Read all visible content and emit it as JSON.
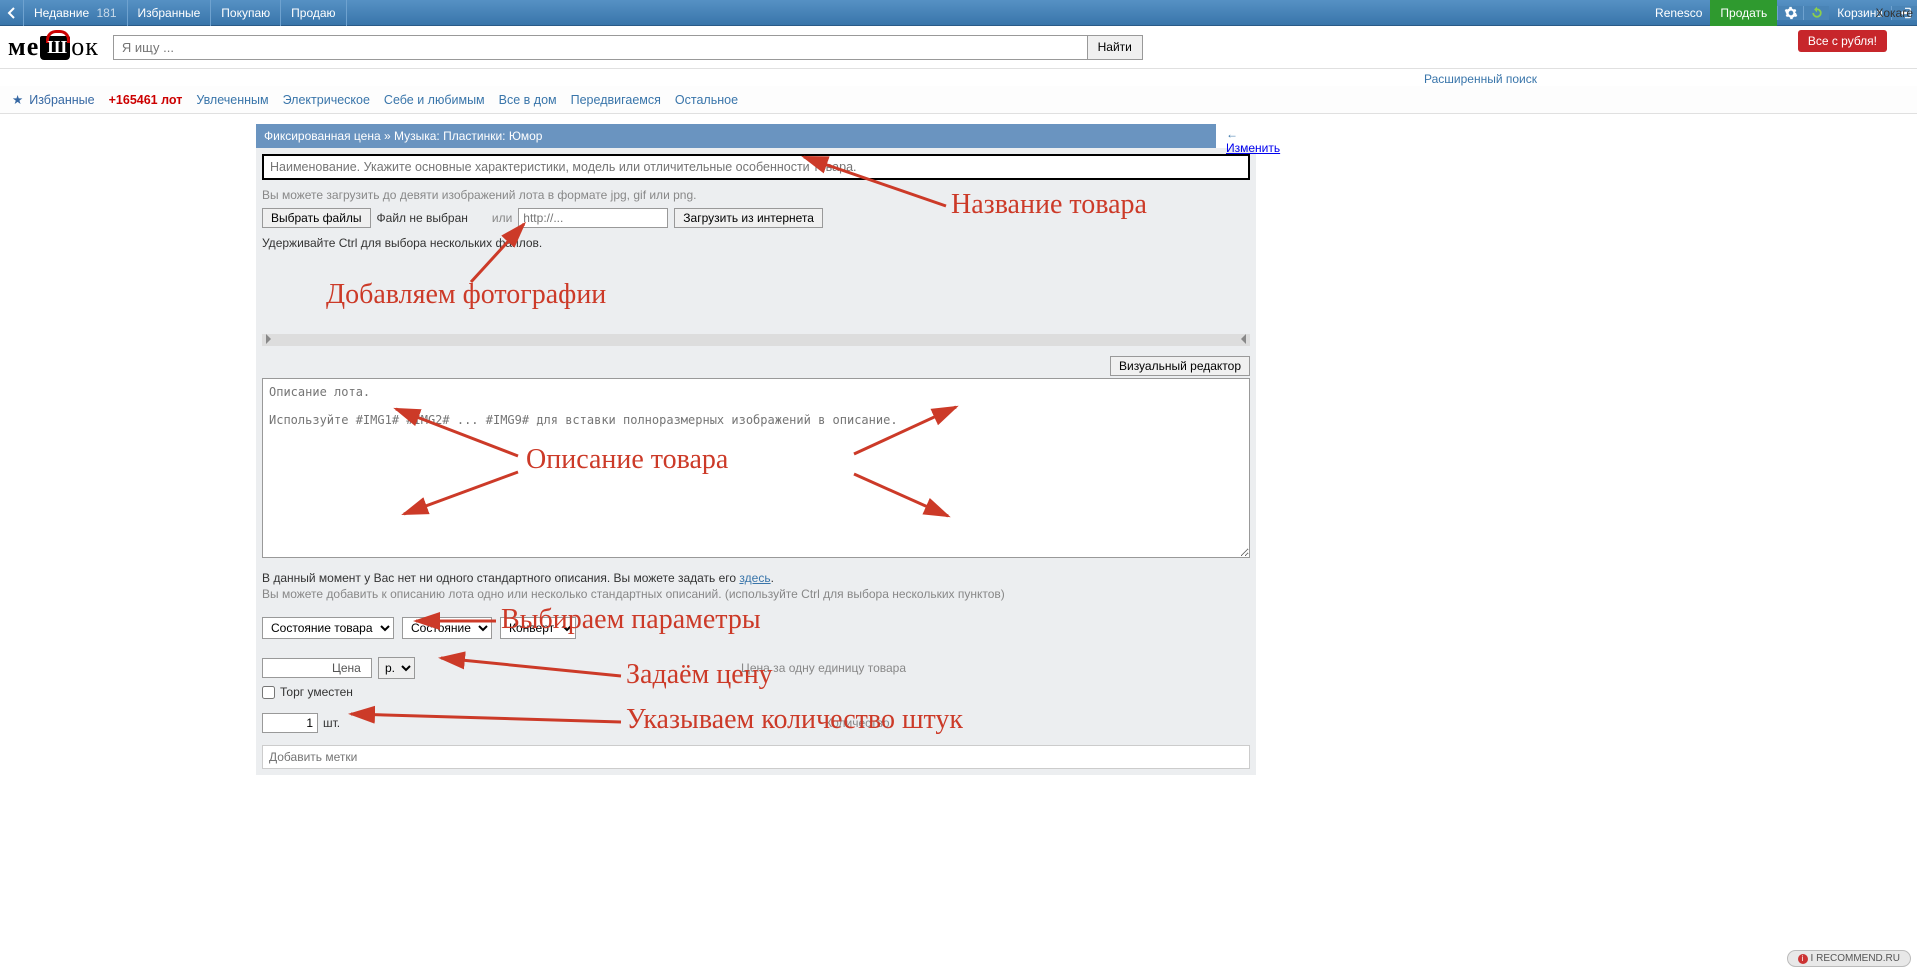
{
  "topnav": {
    "recent": "Недавние",
    "recent_count": "181",
    "favorites": "Избранные",
    "buying": "Покупаю",
    "selling": "Продаю",
    "username": "Renesco",
    "sell": "Продать",
    "cart": "Корзина"
  },
  "corner_user": "Хокаге",
  "logo": {
    "left": "ме",
    "right": "ок"
  },
  "search": {
    "placeholder": "Я ищу ...",
    "button": "Найти",
    "advanced": "Расширенный поиск"
  },
  "promo": "Все с рубля!",
  "categories": {
    "fav": "Избранные",
    "lotcount": "+165461 лот",
    "items": [
      "Увлеченным",
      "Электрическое",
      "Себе и любимым",
      "Все в дом",
      "Передвигаемся",
      "Остальное"
    ]
  },
  "breadcrumb": "Фиксированная цена » Музыка: Пластинки: Юмор",
  "change": "Изменить",
  "title_placeholder": "Наименование. Укажите основные характеристики, модель или отличительные особенности товара.",
  "upload_note": "Вы можете загрузить до девяти изображений лота в формате jpg, gif или png.",
  "choose_files": "Выбрать файлы",
  "no_file": "Файл не выбран",
  "or": "или",
  "url_placeholder": "http://...",
  "load_from_internet": "Загрузить из интернета",
  "ctrl_note": "Удерживайте Ctrl для выбора нескольких файлов.",
  "visual_editor": "Визуальный редактор",
  "desc_placeholder": "Описание лота.\n\nИспользуйте #IMG1# #IMG2# ... #IMG9# для вставки полноразмерных изображений в описание.",
  "std_desc_note_a": "В данный момент у Вас нет ни одного стандартного описания. Вы можете задать его ",
  "std_desc_here": "здесь",
  "std_desc_sub": "Вы можете добавить к описанию лота одно или несколько стандартных описаний. (используйте Ctrl для выбора нескольких пунктов)",
  "selects": {
    "condition": "Состояние товара",
    "state": "Состояние",
    "envelope": "Конверт"
  },
  "price_label": "Цена",
  "currency": "р.",
  "price_unit": "Цена за одну единицу товара",
  "bargain": "Торг уместен",
  "qty_value": "1",
  "qty_suffix": "шт.",
  "qty_label": "Количество",
  "tags_placeholder": "Добавить метки",
  "watermark": "I RECOMMEND.RU",
  "annotations": {
    "title": "Название товара",
    "photos": "Добавляем фотографии",
    "desc": "Описание товара",
    "params": "Выбираем параметры",
    "price": "Задаём цену",
    "qty": "Указываем количество штук"
  }
}
